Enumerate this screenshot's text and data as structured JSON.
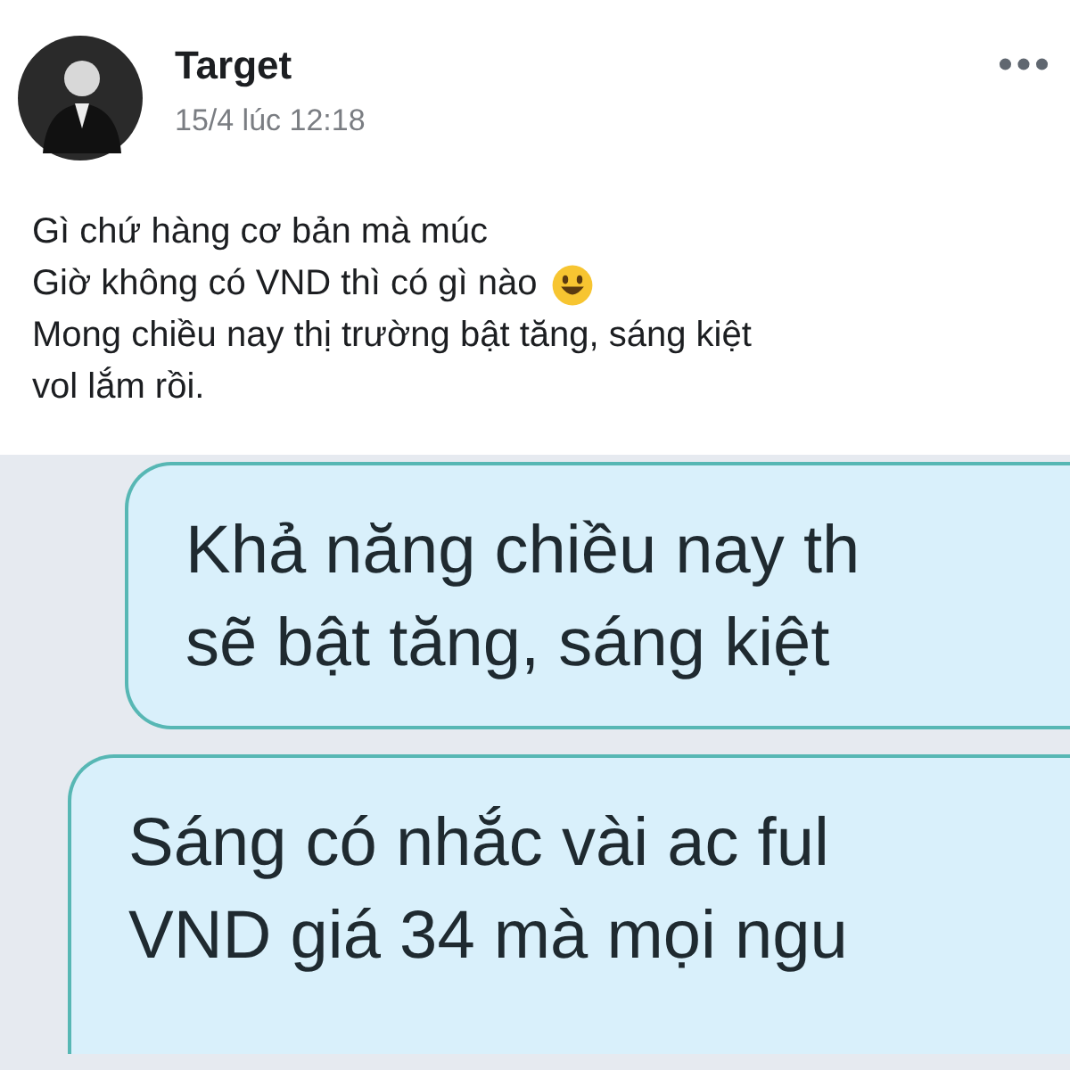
{
  "post": {
    "author": "Target",
    "timestamp": "15/4 lúc 12:18",
    "lines": [
      {
        "text": "Gì chứ hàng cơ bản mà múc",
        "emoji": false
      },
      {
        "text": "Giờ không có VND thì có gì nào",
        "emoji": true
      },
      {
        "text": "Mong chiều nay thị trường bật tăng, sáng kiệt",
        "emoji": false
      },
      {
        "text": "vol lắm rồi.",
        "emoji": false
      }
    ]
  },
  "chat_image": {
    "bubbles": [
      {
        "lines": [
          "Khả năng chiều nay th",
          "sẽ bật tăng, sáng kiệt"
        ]
      },
      {
        "lines": [
          "Sáng có nhắc vài ac ful",
          "VND giá 34 mà mọi ngu"
        ]
      }
    ]
  }
}
